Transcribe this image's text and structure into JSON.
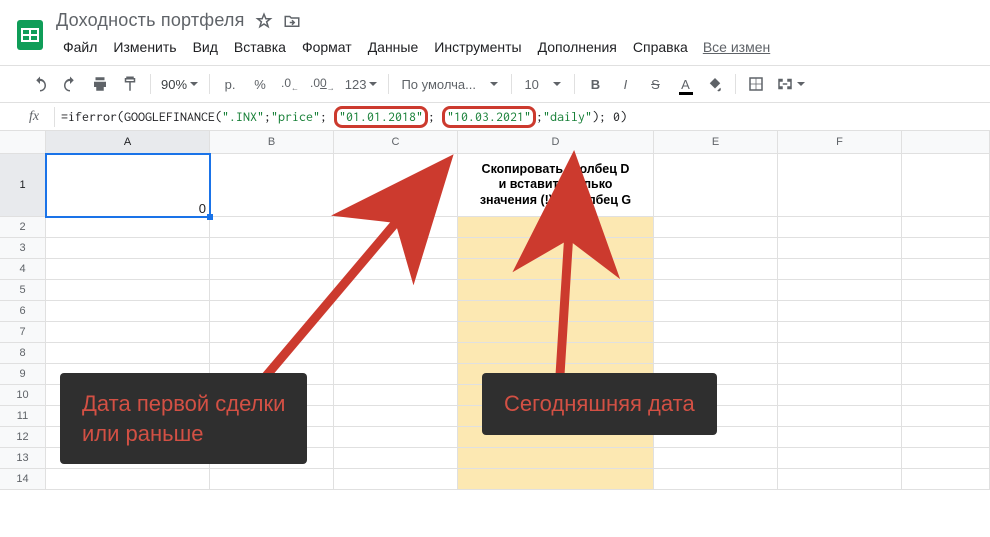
{
  "doc": {
    "title": "Доходность портфеля"
  },
  "menu": {
    "file": "Файл",
    "edit": "Изменить",
    "view": "Вид",
    "insert": "Вставка",
    "format": "Формат",
    "data": "Данные",
    "tools": "Инструменты",
    "addons": "Дополнения",
    "help": "Справка",
    "all_changes": "Все измен"
  },
  "toolbar": {
    "zoom": "90%",
    "currency": "р.",
    "percent": "%",
    "dec_dec": ".0",
    "inc_dec": ".00",
    "more_formats": "123",
    "font": "По умолча...",
    "font_size": "10",
    "bold": "B",
    "italic": "I",
    "strike": "S",
    "text_color": "A"
  },
  "formula": {
    "prefix": "=iferror(",
    "fn": "GOOGLEFINANCE",
    "open": "(",
    "arg1": "\".INX\"",
    "sep": "; ",
    "arg2": "\"price\"",
    "arg3": "\"01.01.2018\"",
    "arg4": "\"10.03.2021\"",
    "arg5": "\"daily\"",
    "close": ")",
    "suffix": "; 0)"
  },
  "columns": [
    "A",
    "B",
    "C",
    "D",
    "E",
    "F"
  ],
  "rows": [
    "1",
    "2",
    "3",
    "4",
    "5",
    "6",
    "7",
    "8",
    "9",
    "10",
    "11",
    "12",
    "13",
    "14"
  ],
  "cells": {
    "A1": "0",
    "D1": "Скопировать столбец D\nи вставить только\nзначения (!) в столбец G"
  },
  "callouts": {
    "left": "Дата первой сделки\nили раньше",
    "right": "Сегодняшняя дата"
  }
}
